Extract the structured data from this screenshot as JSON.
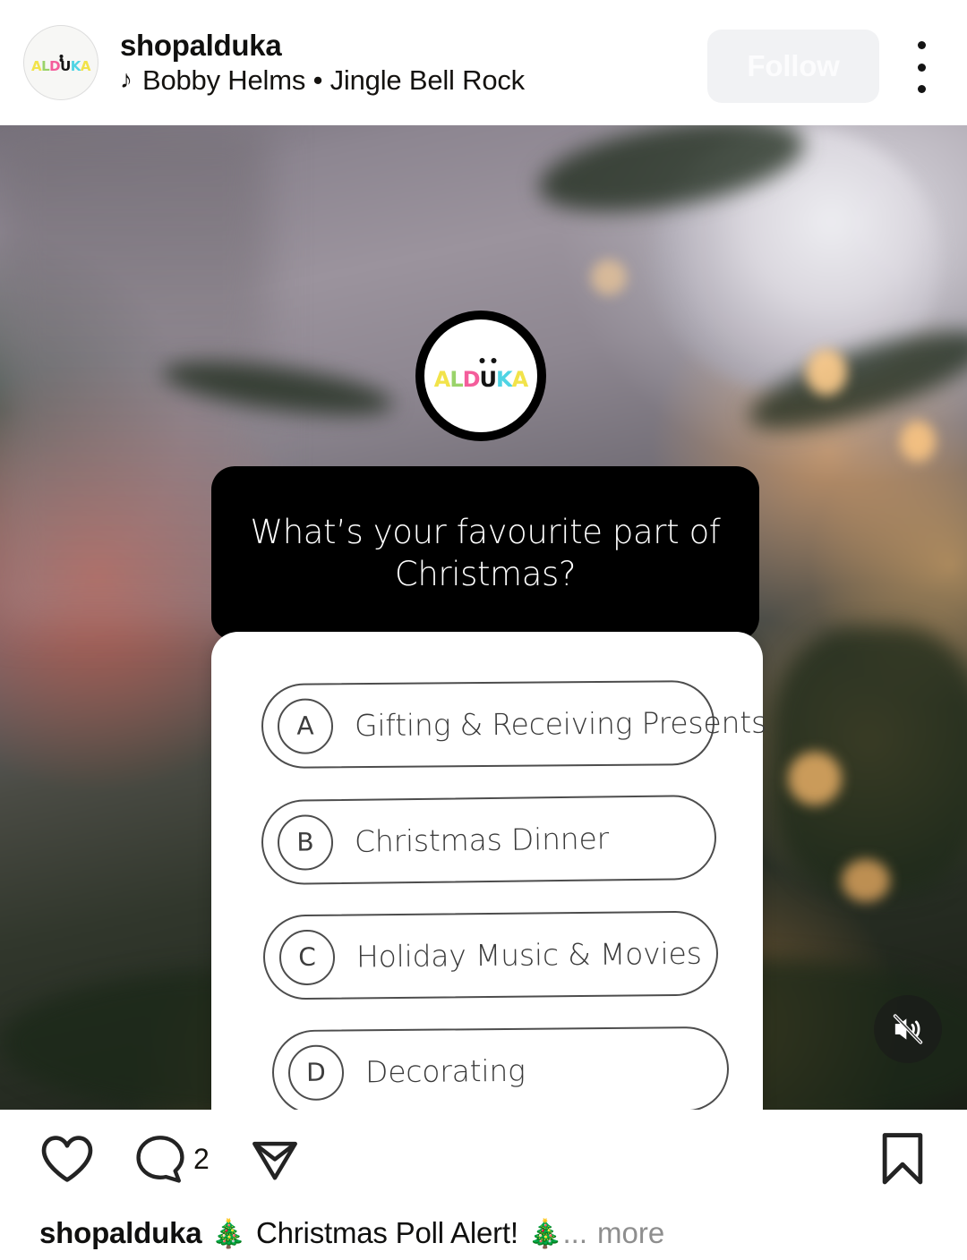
{
  "header": {
    "username": "shopalduka",
    "music_icon": "music-note-icon",
    "music_attribution": "Bobby Helms • Jingle Bell Rock",
    "follow_label": "Follow",
    "more_icon": "more-options-icon",
    "avatar_logo": {
      "letters": [
        "A",
        "L",
        "D",
        "U",
        "K",
        "A"
      ],
      "brand": "ALDUKA",
      "colors": [
        "#f2e34a",
        "#9ad36a",
        "#f45d9b",
        "#141414",
        "#4fd4e4",
        "#f2e34a"
      ]
    }
  },
  "media": {
    "story_logo": {
      "brand": "ALDUKA",
      "letters": [
        "A",
        "L",
        "D",
        "U",
        "K",
        "A"
      ]
    },
    "poll": {
      "question": "What’s your favourite part of Christmas?",
      "options": [
        {
          "key": "A",
          "label": "Gifting & Receiving Presents"
        },
        {
          "key": "B",
          "label": "Christmas Dinner"
        },
        {
          "key": "C",
          "label": "Holiday Music & Movies"
        },
        {
          "key": "D",
          "label": "Decorating"
        }
      ]
    },
    "mute_icon": "speaker-mute-icon",
    "background_colors": {
      "wall": "#8d8691",
      "red_ornament": "#d65640",
      "pine": "#31372c",
      "lights": "#ffb05c",
      "silver_ball": "#dcd9e0"
    }
  },
  "actions": {
    "like_icon": "heart-icon",
    "comment_icon": "comment-icon",
    "comment_count": "2",
    "share_icon": "share-icon",
    "save_icon": "bookmark-icon"
  },
  "caption": {
    "username": "shopalduka",
    "emoji_start": "🎄",
    "text": "Christmas Poll Alert!",
    "emoji_end": "🎄",
    "ellipsis": "...",
    "more_label": "more"
  }
}
